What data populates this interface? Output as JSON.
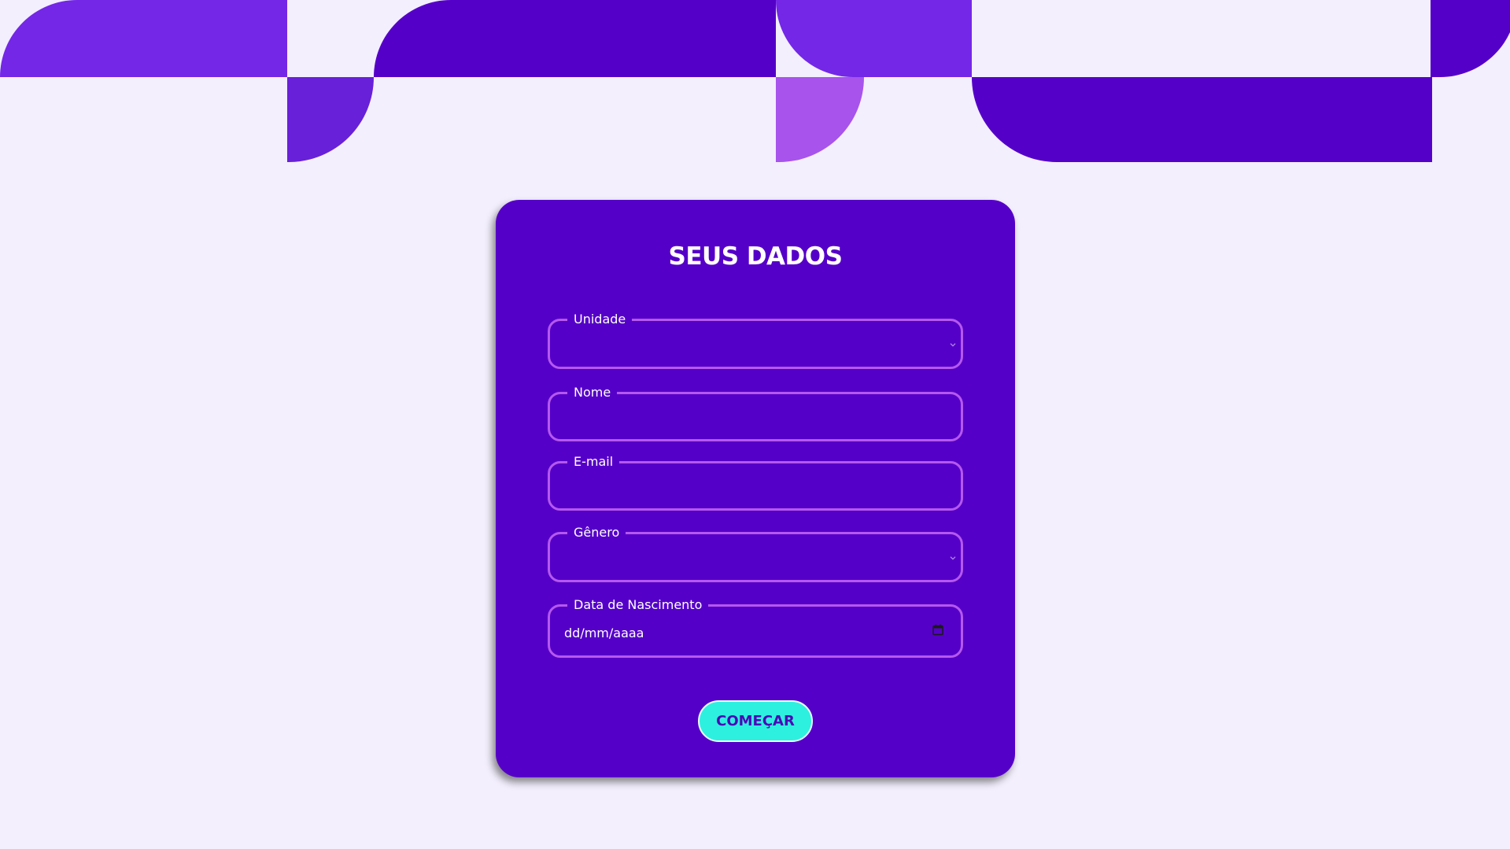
{
  "colors": {
    "page_background": "#f3effd",
    "card_background": "#5500c8",
    "field_border": "#b558ee",
    "button_background": "#2ef0de",
    "button_text": "#4a08b8",
    "shape_dark": "#5500c8",
    "shape_medium": "#7427e6",
    "shape_light": "#a753ec"
  },
  "form": {
    "title": "SEUS DADOS",
    "fields": [
      {
        "label": "Unidade",
        "type": "select",
        "value": ""
      },
      {
        "label": "Nome",
        "type": "text",
        "value": ""
      },
      {
        "label": "E-mail",
        "type": "email",
        "value": ""
      },
      {
        "label": "Gênero",
        "type": "select",
        "value": ""
      },
      {
        "label": "Data de Nascimento",
        "type": "date",
        "value": "dd/mm/aaaa"
      }
    ],
    "submit_label": "COMEÇAR"
  },
  "icons": {
    "select_arrow": "chevron-down-icon",
    "date_picker": "calendar-icon"
  }
}
